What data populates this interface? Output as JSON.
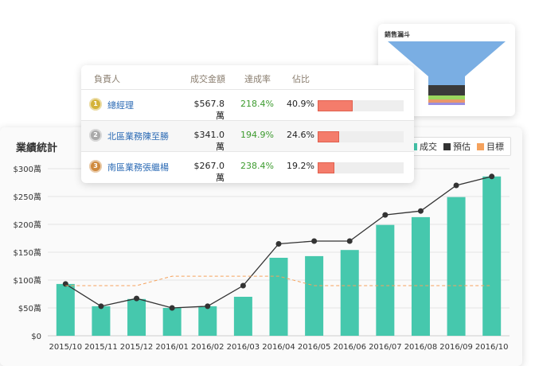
{
  "main_chart": {
    "title": "業績統計",
    "legend": [
      {
        "label": "成交",
        "color": "#46c8ad"
      },
      {
        "label": "預估",
        "color": "#333333"
      },
      {
        "label": "目標",
        "color": "#f5a25d"
      }
    ]
  },
  "chart_data": {
    "type": "bar",
    "categories": [
      "2015/10",
      "2015/11",
      "2015/12",
      "2016/01",
      "2016/02",
      "2016/03",
      "2016/04",
      "2016/05",
      "2016/06",
      "2016/07",
      "2016/08",
      "2016/09",
      "2016/10"
    ],
    "series": [
      {
        "name": "成交",
        "type": "bar",
        "color": "#46c8ad",
        "values": [
          93,
          53,
          66,
          50,
          53,
          70,
          140,
          143,
          154,
          199,
          213,
          249,
          286
        ]
      },
      {
        "name": "預估",
        "type": "line",
        "color": "#333333",
        "values": [
          93,
          53,
          67,
          50,
          53,
          90,
          165,
          170,
          170,
          217,
          224,
          270,
          286
        ]
      },
      {
        "name": "目標",
        "type": "line",
        "dashed": true,
        "color": "#f5a25d",
        "values": [
          90,
          90,
          90,
          107,
          107,
          107,
          107,
          90,
          90,
          90,
          90,
          90,
          90
        ]
      }
    ],
    "yticks": [
      "$0",
      "$50萬",
      "$100萬",
      "$150萬",
      "$200萬",
      "$250萬",
      "$300萬"
    ],
    "ylim": [
      0,
      300
    ],
    "grid": true,
    "legend_position": "top-right"
  },
  "funnel": {
    "title": "銷售漏斗",
    "segments": [
      {
        "color": "#7aaee3",
        "value": 55
      },
      {
        "color": "#3a3a3a",
        "value": 13
      },
      {
        "color": "#9bd65e",
        "value": 5
      },
      {
        "color": "#e9986a",
        "value": 4
      },
      {
        "color": "#9b8fe0",
        "value": 3
      }
    ]
  },
  "sales_table": {
    "headers": {
      "person": "負責人",
      "amount": "成交金額",
      "rate": "達成率",
      "share": "佔比"
    },
    "rows": [
      {
        "rank": "1",
        "medal_color": "#d4b33a",
        "name": "總經理",
        "amount": "$567.8萬",
        "rate": "218.4%",
        "share": "40.9%",
        "share_value": 0.409
      },
      {
        "rank": "2",
        "medal_color": "#a9a9a9",
        "name": "北區業務陳至勝",
        "amount": "$341.0萬",
        "rate": "194.9%",
        "share": "24.6%",
        "share_value": 0.246
      },
      {
        "rank": "3",
        "medal_color": "#cf8a3e",
        "name": "南區業務張繼楊",
        "amount": "$267.0萬",
        "rate": "238.4%",
        "share": "19.2%",
        "share_value": 0.192
      }
    ]
  }
}
